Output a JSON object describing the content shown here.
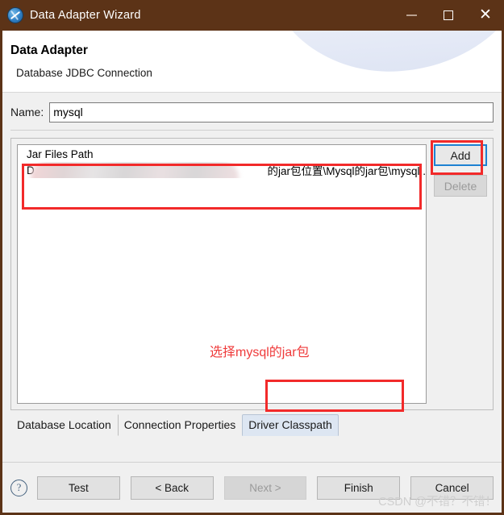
{
  "window": {
    "title": "Data Adapter Wizard",
    "icon": "jasper-compass-icon",
    "controls": {
      "minimize": "–",
      "maximize": "□",
      "close": "✕"
    },
    "titlebar_color": "#5C3317"
  },
  "header": {
    "title": "Data Adapter",
    "subtitle": "Database JDBC Connection"
  },
  "form": {
    "name_label": "Name:",
    "name_value": "mysql",
    "name_placeholder": ""
  },
  "jar_list": {
    "column_header": "Jar Files Path",
    "rows": [
      {
        "text": "D",
        "suffix": "的jar包位置\\Mysql的jar包\\mysql..",
        "redacted": true
      }
    ]
  },
  "side_buttons": {
    "add_label": "Add",
    "delete_label": "Delete"
  },
  "tabs": [
    {
      "label": "Database Location",
      "selected": false
    },
    {
      "label": "Connection Properties",
      "selected": false
    },
    {
      "label": "Driver Classpath",
      "selected": true
    }
  ],
  "annotations": {
    "center_note": "选择mysql的jar包",
    "note_color": "#ef3b3b",
    "box_color": "#f22a2a"
  },
  "footer": {
    "help_icon": "question-mark-icon",
    "help_glyph": "?",
    "buttons": [
      {
        "label": "Test",
        "disabled": false
      },
      {
        "label": "< Back",
        "disabled": false
      },
      {
        "label": "Next >",
        "disabled": true
      },
      {
        "label": "Finish",
        "disabled": false
      },
      {
        "label": "Cancel",
        "disabled": false
      }
    ]
  },
  "watermark": {
    "text": "CSDN @不错？不错！"
  }
}
